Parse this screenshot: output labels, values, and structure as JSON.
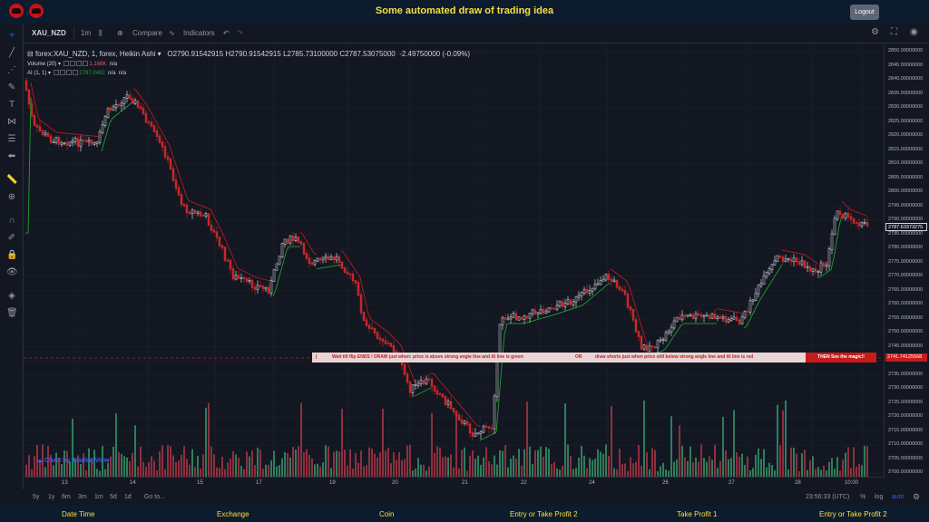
{
  "app": {
    "title": "Some automated draw of trading idea",
    "logout_label": "Logout"
  },
  "toolbar": {
    "symbol": "XAU_NZD",
    "interval": "1m",
    "compare_label": "Compare",
    "indicators_label": "Indicators"
  },
  "legend": {
    "main": "forex:XAU_NZD, 1, forex, Heikin Ashi",
    "open": "O2790.91542915",
    "high": "H2790.91542915",
    "low": "L2785.73100000",
    "close": "C2787.53075000",
    "change": "-2.49750000 (-0.09%)",
    "volume_label": "Volume (20)",
    "volume_value": "1.166K",
    "volume_na": "n/a",
    "ai_label": "AI (1, 1)",
    "ai_value": "2787.0482",
    "ai_na1": "n/a",
    "ai_na2": "n/a"
  },
  "price_axis": {
    "ticks": [
      "2850.00000000",
      "2845.00000000",
      "2840.00000000",
      "2835.00000000",
      "2830.00000000",
      "2825.00000000",
      "2820.00000000",
      "2815.00000000",
      "2810.00000000",
      "2805.00000000",
      "2800.00000000",
      "2795.00000000",
      "2790.00000000",
      "2785.00000000",
      "2780.00000000",
      "2775.00000000",
      "2770.00000000",
      "2765.00000000",
      "2760.00000000",
      "2755.00000000",
      "2750.00000000",
      "2745.00000000",
      "2740.00000000",
      "2735.00000000",
      "2730.00000000",
      "2725.00000000",
      "2720.00000000",
      "2715.00000000",
      "2710.00000000",
      "2705.00000000",
      "2700.00000000"
    ],
    "current_price": "2787.63373275",
    "line_price": "2741.74125568",
    "current_color": "#ffffff",
    "line_color": "#c61b1b"
  },
  "time_axis": {
    "ticks": [
      "13",
      "14",
      "15",
      "17",
      "19",
      "20",
      "21",
      "22",
      "24",
      "26",
      "27",
      "28",
      "10:00"
    ]
  },
  "range_bar": {
    "ranges": [
      "5y",
      "1y",
      "6m",
      "3m",
      "1m",
      "5d",
      "1d"
    ],
    "goto": "Go to...",
    "clock": "23:56:33 (UTC)",
    "percent": "%",
    "log": "log",
    "auto": "auto"
  },
  "banner": {
    "part1": "Wait till flip ENDS  !   DRAW just when:  price is above strong angle line and AI line is green",
    "or": "OR",
    "part2": "draw shorts just when price still below strong angle line and AI line is red",
    "magic": "THEN See the magic!!"
  },
  "watermark": "Chart by TradingView",
  "bottom_columns": [
    "Date Time",
    "Exchange",
    "Coin",
    "Entry or Take Profit 2",
    "Take Profit 1",
    "Entry or Take Profit 2"
  ],
  "colors": {
    "up": "#e8e8e8",
    "down": "#c62828",
    "ai_up": "#1ba32b",
    "ai_down": "#b71c1c",
    "vol_up": "#2e7d5b",
    "vol_down": "#8e2f3e",
    "accent": "#f5e03a"
  }
}
